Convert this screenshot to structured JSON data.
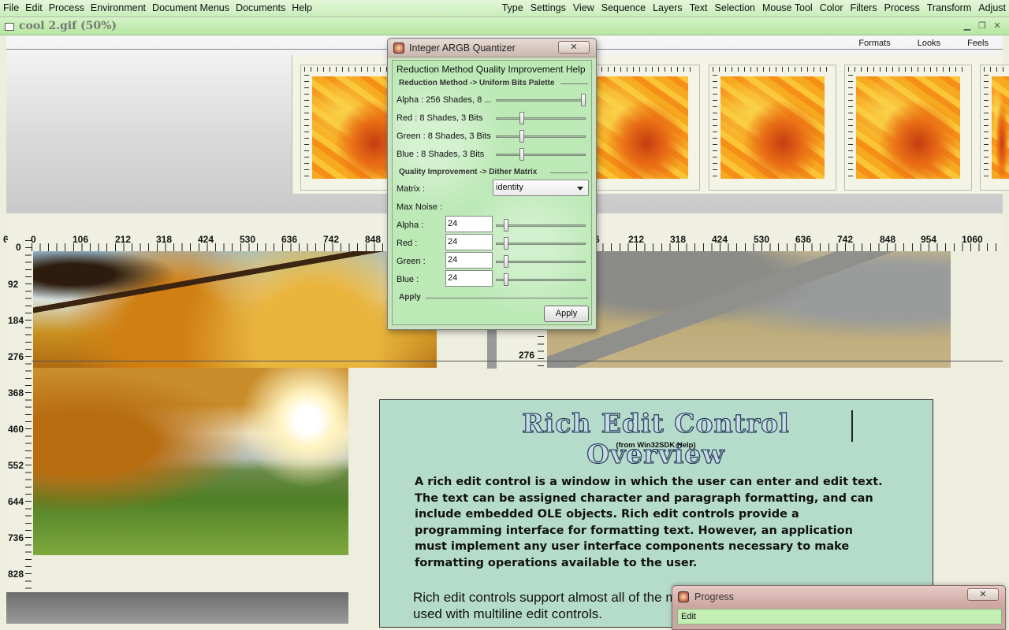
{
  "menubar": {
    "left": [
      "File",
      "Edit",
      "Process",
      "Environment",
      "Document Menus",
      "Documents",
      "Help"
    ],
    "right": [
      "Type",
      "Settings",
      "View",
      "Sequence",
      "Layers",
      "Text",
      "Selection",
      "Mouse Tool",
      "Color",
      "Filters",
      "Process",
      "Transform",
      "Adjust"
    ]
  },
  "document": {
    "title": "cool 2.gif (50%)",
    "tabs": [
      "Formats",
      "Looks",
      "Feels"
    ]
  },
  "rulers": {
    "left_top": [
      "6",
      "0",
      "106",
      "212",
      "318",
      "424",
      "530",
      "636",
      "742",
      "848"
    ],
    "right_top": [
      "6",
      "212",
      "318",
      "424",
      "530",
      "636",
      "742",
      "848",
      "954",
      "1060"
    ],
    "vertical": [
      "0",
      "92",
      "184",
      "276",
      "368",
      "460",
      "552",
      "644",
      "736",
      "828"
    ],
    "right_vertical_label": "276"
  },
  "richdoc": {
    "heading": "Rich Edit Control Overview",
    "subheading": "(from Win32SDK Help)",
    "para1": "A rich edit control is a window in which the user can enter and edit text. The text can be assigned character and paragraph formatting, and can include embedded OLE objects. Rich edit controls provide a programming interface for formatting text. However, an application must implement any user interface components necessary to make formatting operations available to the user.",
    "para2": "Rich edit controls support almost all of the messages and notifications messages used with multiline edit controls."
  },
  "quantizer": {
    "title": "Integer ARGB Quantizer",
    "close": "✕",
    "menu": [
      "Reduction Method",
      "Quality Improvement",
      "Help"
    ],
    "section1": "Reduction Method -> Uniform Bits Palette",
    "channels": [
      {
        "label": "Alpha : 256 Shades, 8 ...",
        "level": 1.0
      },
      {
        "label": "Red :   8 Shades, 3 Bits",
        "level": 0.28
      },
      {
        "label": "Green : 8 Shades, 3 Bits",
        "level": 0.28
      },
      {
        "label": "Blue :   8 Shades, 3 Bits",
        "level": 0.28
      }
    ],
    "section2": "Quality Improvement -> Dither Matrix",
    "matrix_label": "Matrix :",
    "matrix_value": "identity",
    "max_noise_label": "Max Noise :",
    "noise": [
      {
        "label": "Alpha :",
        "value": "24",
        "level": 0.09
      },
      {
        "label": "Red :",
        "value": "24",
        "level": 0.09
      },
      {
        "label": "Green :",
        "value": "24",
        "level": 0.09
      },
      {
        "label": "Blue :",
        "value": "24",
        "level": 0.09
      }
    ],
    "section3": "Apply",
    "apply_button": "Apply"
  },
  "progress": {
    "title": "Progress",
    "close": "✕",
    "status": "Edit"
  }
}
